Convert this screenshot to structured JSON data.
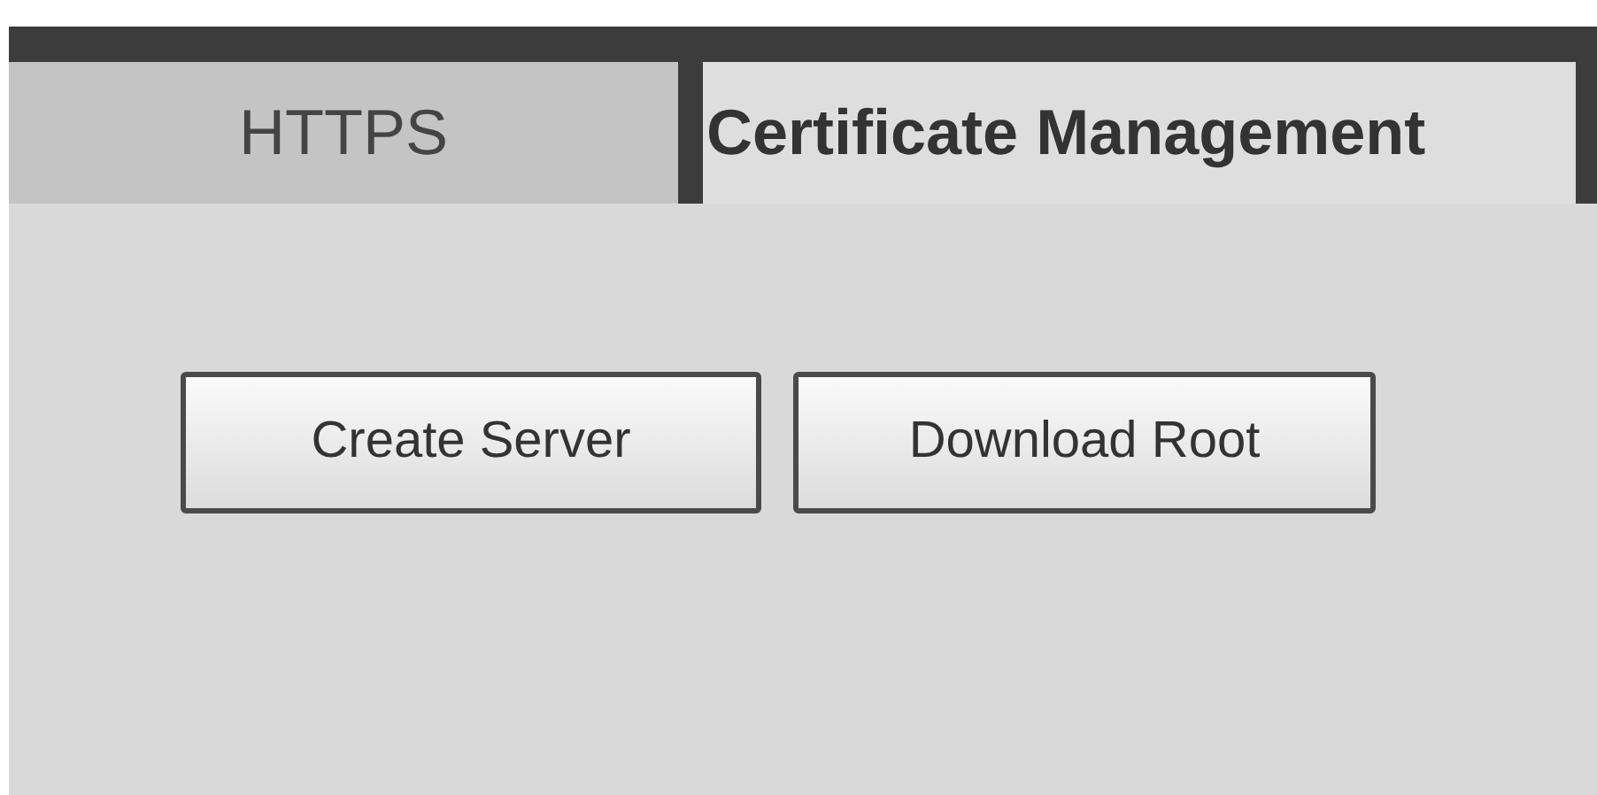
{
  "tabs": [
    {
      "label": "HTTPS",
      "selected": false
    },
    {
      "label": "Certificate Management",
      "selected": true
    }
  ],
  "buttons": [
    "Create Server",
    "Download Root"
  ]
}
